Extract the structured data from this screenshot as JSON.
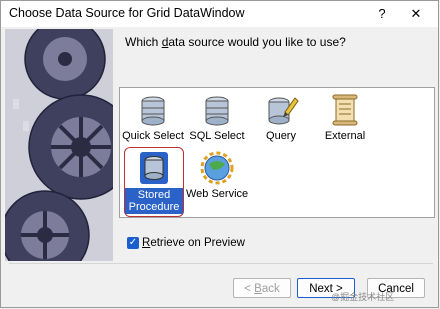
{
  "window": {
    "title": "Choose Data Source for Grid DataWindow",
    "help_label": "?",
    "close_label": "✕"
  },
  "main": {
    "question_pre": "Which ",
    "question_mnemonic": "d",
    "question_post": "ata source would you like to use?"
  },
  "sources": [
    {
      "label": "Quick Select",
      "icon": "database-icon"
    },
    {
      "label": "SQL Select",
      "icon": "database-icon"
    },
    {
      "label": "Query",
      "icon": "query-database-icon"
    },
    {
      "label": "External",
      "icon": "scroll-icon"
    },
    {
      "label_line1": "Stored",
      "label_line2": "Procedure",
      "icon": "stored-procedure-icon",
      "selected": true
    },
    {
      "label": "Web Service",
      "icon": "web-service-globe-icon"
    }
  ],
  "options": {
    "retrieve_checked": true,
    "retrieve_mnemonic": "R",
    "retrieve_rest": "etrieve on Preview"
  },
  "buttons": {
    "back_arrow": "< ",
    "back_mnemonic": "B",
    "back_rest": "ack",
    "next_label": "Next >",
    "cancel_label": "Cancel"
  },
  "watermark": "@掘金技术社区",
  "colors": {
    "selection": "#2a62c8",
    "highlight_ring": "#c03030",
    "checkbox": "#1a5fd0"
  }
}
